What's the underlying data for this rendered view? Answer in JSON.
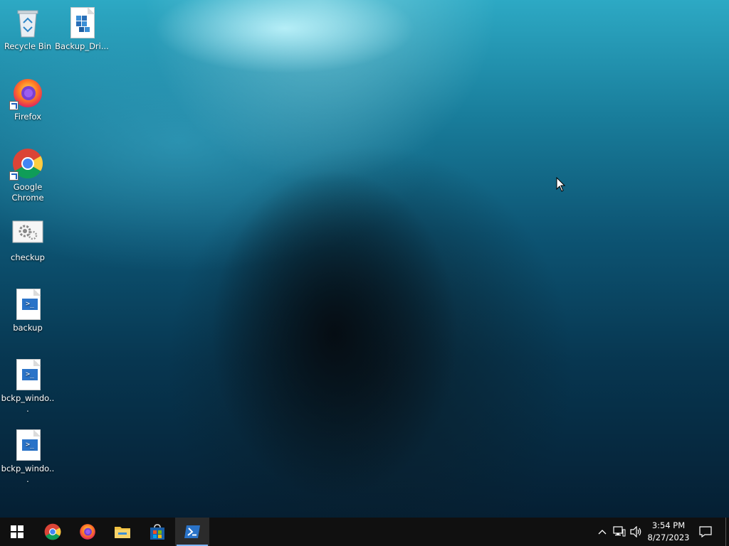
{
  "desktop": {
    "icons": [
      {
        "id": "recycle-bin",
        "label": "Recycle Bin"
      },
      {
        "id": "backup-drive",
        "label": "Backup_Dri..."
      },
      {
        "id": "firefox",
        "label": "Firefox"
      },
      {
        "id": "google-chrome",
        "label": "Google Chrome"
      },
      {
        "id": "checkup",
        "label": "checkup"
      },
      {
        "id": "backup",
        "label": "backup"
      },
      {
        "id": "bckp-windows-1",
        "label": "bckp_windo..."
      },
      {
        "id": "bckp-windows-2",
        "label": "bckp_windo..."
      }
    ]
  },
  "taskbar": {
    "start": {
      "icon": "windows-logo-icon"
    },
    "pinned": [
      {
        "name": "Google Chrome",
        "icon": "chrome-icon"
      },
      {
        "name": "Firefox",
        "icon": "firefox-icon"
      },
      {
        "name": "File Explorer",
        "icon": "folder-icon"
      },
      {
        "name": "Microsoft Store",
        "icon": "store-icon"
      },
      {
        "name": "Windows PowerShell",
        "icon": "powershell-icon",
        "active": true
      }
    ],
    "tray": {
      "time": "3:54 PM",
      "date": "8/27/2023"
    }
  },
  "colors": {
    "taskbar_bg": "#101010",
    "active_indicator": "#7fb7ff",
    "powershell_blue": "#2a73c8"
  }
}
